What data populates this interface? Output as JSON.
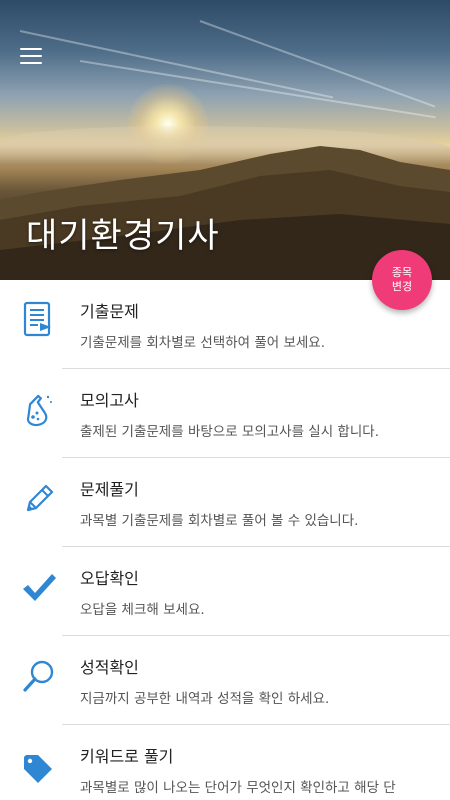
{
  "header": {
    "title": "대기환경기사",
    "menu_icon": "hamburger-menu-icon"
  },
  "fab": {
    "line1": "종목",
    "line2": "변경",
    "color": "#ef3b77"
  },
  "accent_color": "#2f87d4",
  "items": [
    {
      "title": "기출문제",
      "desc": "기출문제를 회차별로 선택하여 풀어 보세요.",
      "icon": "exam-document-icon"
    },
    {
      "title": "모의고사",
      "desc": "출제된 기출문제를 바탕으로 모의고사를 실시 합니다.",
      "icon": "flask-icon"
    },
    {
      "title": "문제풀기",
      "desc": "과목별 기출문제를 회차별로 풀어 볼 수 있습니다.",
      "icon": "pencil-icon"
    },
    {
      "title": "오답확인",
      "desc": "오답을 체크해 보세요.",
      "icon": "checkmark-icon"
    },
    {
      "title": "성적확인",
      "desc": "지금까지 공부한 내역과 성적을 확인 하세요.",
      "icon": "magnifier-icon"
    },
    {
      "title": "키워드로 풀기",
      "desc": "과목별로 많이 나오는 단어가 무엇인지 확인하고 해당 단",
      "icon": "tag-icon"
    }
  ]
}
